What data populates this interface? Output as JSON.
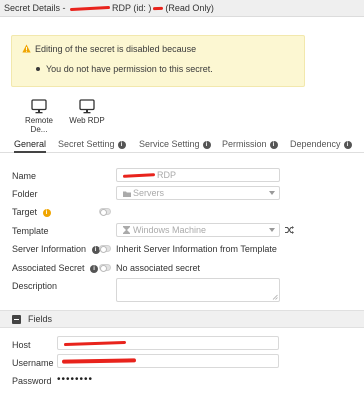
{
  "titlebar": {
    "prefix": "Secret Details - ",
    "mid": "RDP (id: )",
    "suffix": "(Read Only)"
  },
  "warning": {
    "title": "Editing of the secret is disabled because",
    "items": [
      "You do not have permission to this secret."
    ],
    "icon": "warning-icon",
    "color": "#f0a500"
  },
  "launchers": [
    {
      "label": "Remote De...",
      "icon": "monitor-icon"
    },
    {
      "label": "Web RDP",
      "icon": "monitor-icon"
    }
  ],
  "tabs": [
    {
      "label": "General",
      "active": true,
      "info": false
    },
    {
      "label": "Secret Setting",
      "active": false,
      "info": true
    },
    {
      "label": "Service Setting",
      "active": false,
      "info": true
    },
    {
      "label": "Permission",
      "active": false,
      "info": true
    },
    {
      "label": "Dependency",
      "active": false,
      "info": true
    }
  ],
  "form": {
    "name": {
      "label": "Name",
      "value": "RDP"
    },
    "folder": {
      "label": "Folder",
      "value": "Servers"
    },
    "target": {
      "label": "Target"
    },
    "template": {
      "label": "Template",
      "value": "Windows Machine"
    },
    "server_information": {
      "label": "Server Information",
      "value": "Inherit Server Information from Template"
    },
    "associated_secret": {
      "label": "Associated Secret",
      "value": "No associated secret"
    },
    "description": {
      "label": "Description",
      "value": ""
    }
  },
  "fields": {
    "title": "Fields",
    "host": {
      "label": "Host",
      "value": ""
    },
    "username": {
      "label": "Username",
      "value": ""
    },
    "password": {
      "label": "Password",
      "value": "••••••••"
    }
  },
  "colors": {
    "redaction": "#e8231c",
    "warning_bg": "#fcf7d2",
    "target_info": "#f0a500"
  }
}
